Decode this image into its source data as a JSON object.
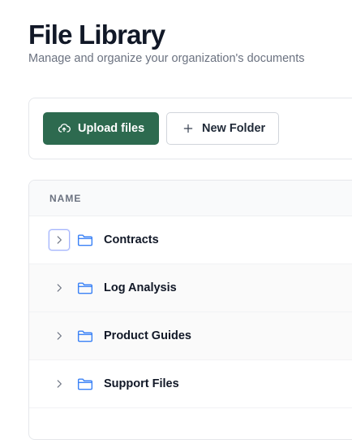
{
  "header": {
    "title": "File Library",
    "subtitle": "Manage and organize your organization's documents"
  },
  "toolbar": {
    "upload_label": "Upload files",
    "upload_icon": "cloud-upload-icon",
    "new_folder_label": "New Folder",
    "new_folder_icon": "plus-icon"
  },
  "table": {
    "column_name": "NAME",
    "rows": [
      {
        "name": "Contracts",
        "icon": "folder-icon",
        "expander": "chevron-right-icon"
      },
      {
        "name": "Log Analysis",
        "icon": "folder-icon",
        "expander": "chevron-right-icon"
      },
      {
        "name": "Product Guides",
        "icon": "folder-icon",
        "expander": "chevron-right-icon"
      },
      {
        "name": "Support Files",
        "icon": "folder-icon",
        "expander": "chevron-right-icon"
      }
    ]
  },
  "colors": {
    "primary": "#2d6a4f",
    "folder": "#3b82f6",
    "focus_ring": "#a5b4fc"
  }
}
